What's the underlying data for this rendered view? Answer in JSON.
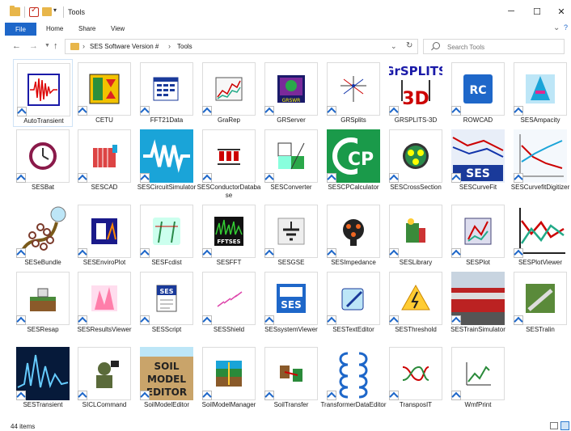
{
  "window": {
    "title": "Tools",
    "controls": {
      "minimize": "─",
      "maximize": "☐",
      "close": "✕"
    }
  },
  "ribbon": {
    "tabs": [
      "File",
      "Home",
      "Share",
      "View"
    ]
  },
  "address": {
    "crumbs": [
      "SES Software Version #",
      "Tools"
    ],
    "search_placeholder": "Search Tools"
  },
  "items": [
    {
      "label": "AutoTransient",
      "icon": "autotransient-icon"
    },
    {
      "label": "CETU",
      "icon": "cetu-icon"
    },
    {
      "label": "FFT21Data",
      "icon": "fft21data-icon"
    },
    {
      "label": "GraRep",
      "icon": "grarep-icon"
    },
    {
      "label": "GRServer",
      "icon": "grserver-icon"
    },
    {
      "label": "GRSplits",
      "icon": "grsplits-icon"
    },
    {
      "label": "GRSPLITS-3D",
      "icon": "grsplits-3d-icon"
    },
    {
      "label": "ROWCAD",
      "icon": "rowcad-icon"
    },
    {
      "label": "SESAmpacity",
      "icon": "sesampacity-icon"
    },
    {
      "label": "SESBat",
      "icon": "sesbat-icon"
    },
    {
      "label": "SESCAD",
      "icon": "sescad-icon"
    },
    {
      "label": "SESCircuitSimulator",
      "icon": "sescircuitsimulator-icon"
    },
    {
      "label": "SESConductorDatabase",
      "icon": "sesconductordatabase-icon"
    },
    {
      "label": "SESConverter",
      "icon": "sesconverter-icon"
    },
    {
      "label": "SESCPCalculator",
      "icon": "sescpcalculator-icon"
    },
    {
      "label": "SESCrossSection",
      "icon": "sescrosssection-icon"
    },
    {
      "label": "SESCurveFit",
      "icon": "sescurvefit-icon"
    },
    {
      "label": "SESCurvefitDigitizer",
      "icon": "sescurvefitdigitizer-icon"
    },
    {
      "label": "SESeBundle",
      "icon": "sesebundle-icon"
    },
    {
      "label": "SESEnviroPlot",
      "icon": "sesenviroplot-icon"
    },
    {
      "label": "SESFcdist",
      "icon": "sesfcdist-icon"
    },
    {
      "label": "SESFFT",
      "icon": "sesfft-icon"
    },
    {
      "label": "SESGSE",
      "icon": "sesgse-icon"
    },
    {
      "label": "SESImpedance",
      "icon": "sesimpedance-icon"
    },
    {
      "label": "SESLibrary",
      "icon": "seslibrary-icon"
    },
    {
      "label": "SESPlot",
      "icon": "sesplot-icon"
    },
    {
      "label": "SESPlotViewer",
      "icon": "sesplotviewer-icon"
    },
    {
      "label": "SESResap",
      "icon": "sesresap-icon"
    },
    {
      "label": "SESResultsViewer",
      "icon": "sesresultsviewer-icon"
    },
    {
      "label": "SESScript",
      "icon": "sesscript-icon"
    },
    {
      "label": "SESShield",
      "icon": "sesshield-icon"
    },
    {
      "label": "SESsystemViewer",
      "icon": "sessystemviewer-icon"
    },
    {
      "label": "SESTextEditor",
      "icon": "sestexteditor-icon"
    },
    {
      "label": "SESThreshold",
      "icon": "sesthreshold-icon"
    },
    {
      "label": "SESTrainSimulator",
      "icon": "sestrainsimulator-icon"
    },
    {
      "label": "SESTralin",
      "icon": "sestralin-icon"
    },
    {
      "label": "SESTransient",
      "icon": "sestransient-icon"
    },
    {
      "label": "SICLCommand",
      "icon": "siclcommand-icon"
    },
    {
      "label": "SoilModelEditor",
      "icon": "soilmodeleditor-icon"
    },
    {
      "label": "SoilModelManager",
      "icon": "soilmodelmanager-icon"
    },
    {
      "label": "SoilTransfer",
      "icon": "soiltransfer-icon"
    },
    {
      "label": "TransformerDataEditor",
      "icon": "transformerdataeditor-icon"
    },
    {
      "label": "TransposIT",
      "icon": "transposit-icon"
    },
    {
      "label": "WmfPrint",
      "icon": "wmfprint-icon"
    }
  ],
  "icon_text": {
    "fftses": "FFTSES",
    "grsplits_top": "GrSPLITS",
    "grsplits_bottom": "3D",
    "rowcad": "RC",
    "grsw": "GRSWR",
    "ses": "SES",
    "cp": "CP",
    "soil": "SOIL",
    "model": "MODEL",
    "editor": "EDITOR"
  },
  "status": {
    "item_count": "44 items"
  },
  "colors": {
    "accent": "#1e67c9",
    "folder": "#e8b64a"
  }
}
